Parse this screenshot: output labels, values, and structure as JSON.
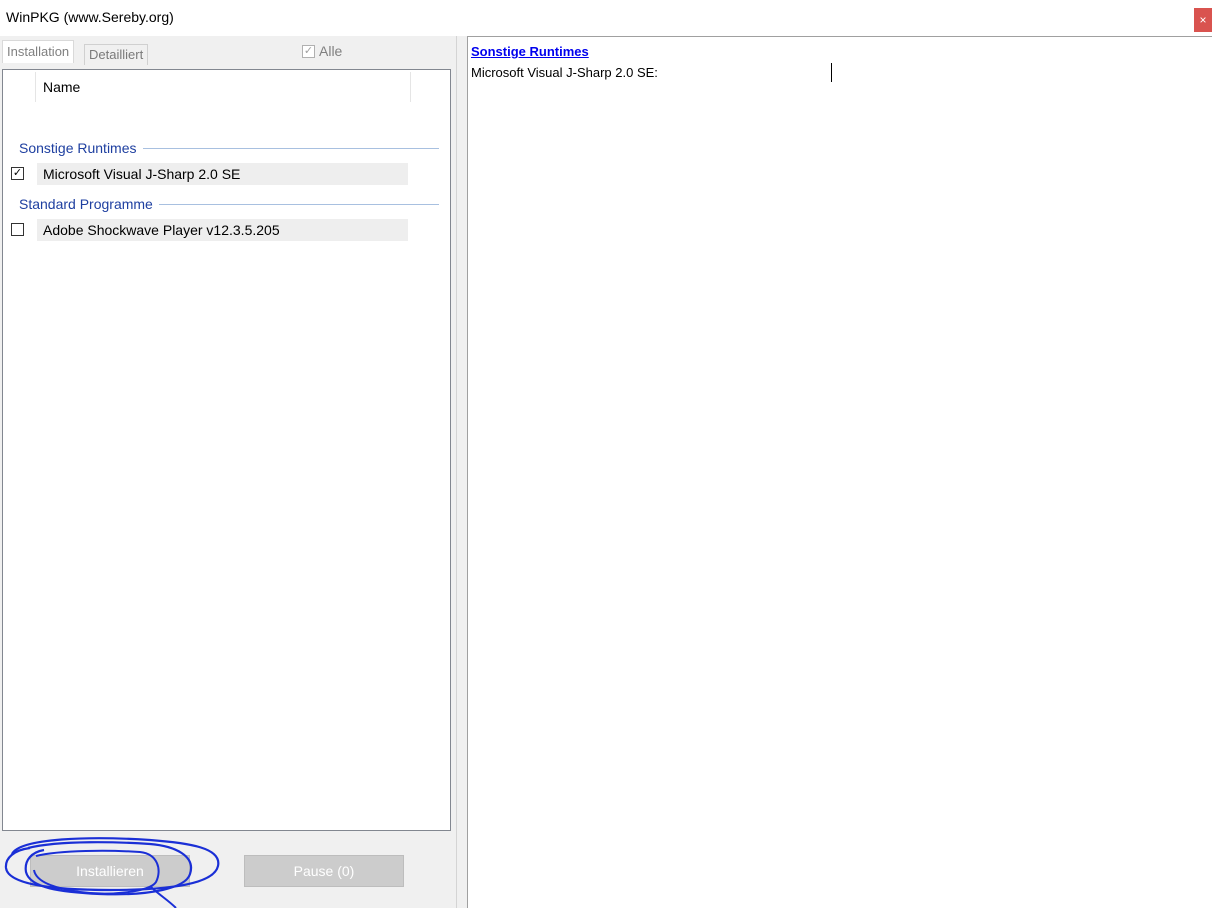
{
  "window": {
    "title": "WinPKG (www.Sereby.org)",
    "close_label": "×"
  },
  "left_pane": {
    "tabs": [
      {
        "label": "Installation",
        "active": true
      },
      {
        "label": "Detailliert",
        "active": false
      }
    ],
    "select_all": {
      "label": "Alle",
      "checked": true,
      "enabled": false
    },
    "list": {
      "column_header": "Name",
      "groups": [
        {
          "name": "Sonstige Runtimes",
          "items": [
            {
              "label": "Microsoft Visual J-Sharp 2.0 SE",
              "checked": true
            }
          ]
        },
        {
          "name": "Standard Programme",
          "items": [
            {
              "label": "Adobe Shockwave Player v12.3.5.205",
              "checked": false
            }
          ]
        }
      ]
    },
    "buttons": {
      "install_label": "Installieren",
      "pause_label": "Pause (0)"
    },
    "check_mark": "✓"
  },
  "right_pane": {
    "heading": "Sonstige Runtimes",
    "detail_line": "Microsoft Visual J-Sharp 2.0 SE:"
  },
  "colors": {
    "group_header": "#1e3fa0",
    "link": "#0000ee",
    "annotation_ink": "#1a2fd6",
    "close_button": "#d9534f"
  }
}
